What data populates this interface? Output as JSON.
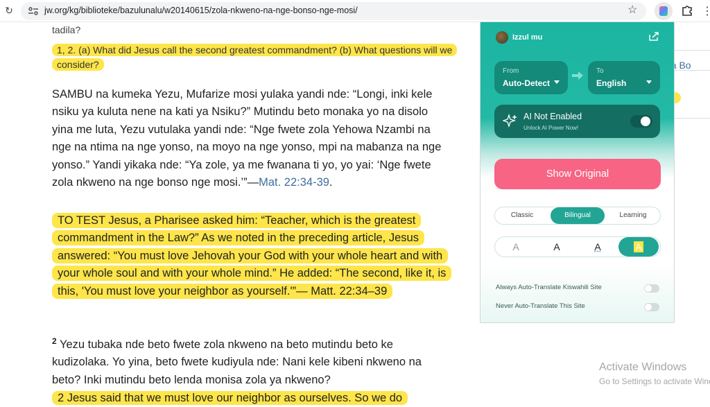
{
  "browser": {
    "url": "jw.org/kg/biblioteke/bazulunalu/w20140615/zola-nkweno-na-nge-bonso-nge-mosi/"
  },
  "article": {
    "tadila": "tadila?",
    "question": "1, 2. (a) What did Jesus call the second greatest commandment? (b) What questions will we consider?",
    "para1": "SAMBU na kumeka Yezu, Mufarize mosi yulaka yandi nde: “Longi, inki kele nsiku ya kuluta nene na kati ya Nsiku?” Mutindu beto monaka yo na disolo yina me luta, Yezu vutulaka yandi nde: “Nge fwete zola Yehowa Nzambi na nge na ntima na nge yonso, na moyo na nge yonso, mpi na mabanza na nge yonso.” Yandi yikaka nde: “Ya zole, ya me fwanana ti yo, yo yai: ‘Nge fwete zola nkweno na nge bonso nge mosi.’”—",
    "para1_ref": "Mat. 22:34-39",
    "para1_end": ".",
    "para1_translation": "TO TEST Jesus, a Pharisee asked him: “Teacher, which is the greatest commandment in the Law?” As we noted in the preceding article, Jesus answered: “You must love Jehovah your God with your whole heart and with your whole soul and with your whole mind.” He added: “The second, like it, is this, 'You must love your neighbor as yourself.'”— Matt. 22:34–39",
    "para2_num": "2",
    "para2": "Yezu tubaka nde beto fwete zola nkweno na beto mutindu beto ke kudizolaka. Yo yina, beto fwete kudiyula nde: Nani kele kibeni nkweno na beto? Inki mutindu beto lenda monisa zola ya nkweno?",
    "para2_translation": "2 Jesus said that we must love our neighbor as ourselves. So we do"
  },
  "side": {
    "partial_link": "na Bo"
  },
  "watermark": {
    "title": "Activate Windows",
    "sub": "Go to Settings to activate Windows."
  },
  "popup": {
    "user": "Izzul mu",
    "from_caption": "From",
    "from_value": "Auto-Detect",
    "to_caption": "To",
    "to_value": "English",
    "ai_title": "AI Not Enabled",
    "ai_sub": "Unlock AI Power Now!",
    "show_original": "Show Original",
    "modes": [
      "Classic",
      "Bilingual",
      "Learning"
    ],
    "selected_mode": "Bilingual",
    "style_glyph": "A",
    "option1": "Always Auto-Translate Kiswahili Site",
    "option2": "Never Auto-Translate This Site",
    "accent": "#22a594",
    "button_color": "#f76484"
  }
}
